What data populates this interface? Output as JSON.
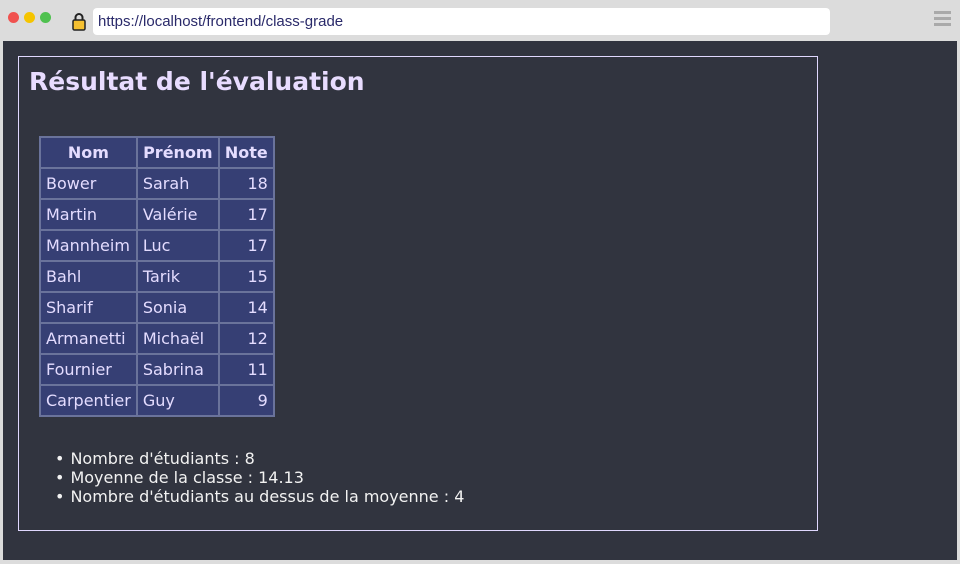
{
  "browser": {
    "url": "https://localhost/frontend/class-grade",
    "icons": {
      "lock": "lock-icon",
      "menu": "hamburger-menu-icon"
    },
    "window_controls": [
      "close",
      "minimize",
      "maximize"
    ]
  },
  "page": {
    "title": "Résultat de l'évaluation",
    "table": {
      "headers": [
        "Nom",
        "Prénom",
        "Note"
      ],
      "rows": [
        [
          "Bower",
          "Sarah",
          "18"
        ],
        [
          "Martin",
          "Valérie",
          "17"
        ],
        [
          "Mannheim",
          "Luc",
          "17"
        ],
        [
          "Bahl",
          "Tarik",
          "15"
        ],
        [
          "Sharif",
          "Sonia",
          "14"
        ],
        [
          "Armanetti",
          "Michaël",
          "12"
        ],
        [
          "Fournier",
          "Sabrina",
          "11"
        ],
        [
          "Carpentier",
          "Guy",
          "9"
        ]
      ]
    },
    "stats": [
      "Nombre d'étudiants : 8",
      "Moyenne de la classe : 14.13",
      "Nombre d'étudiants au dessus de la moyenne : 4"
    ]
  },
  "colors": {
    "background": "#31343f",
    "table_bg": "#363f74",
    "table_border": "#6a739b",
    "title": "#e8dcff"
  }
}
